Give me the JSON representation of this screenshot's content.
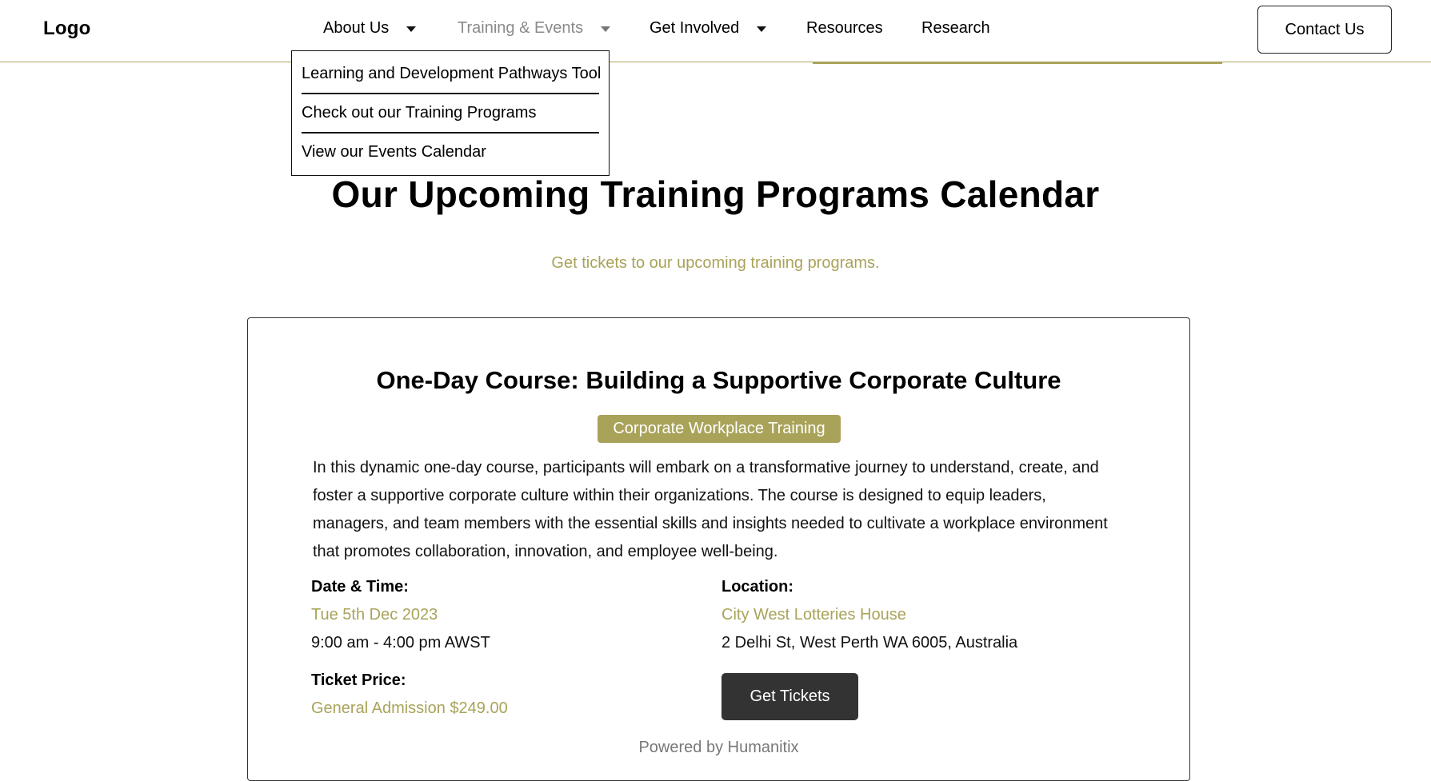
{
  "header": {
    "logo": "Logo",
    "nav": [
      {
        "label": "About Us"
      },
      {
        "label": "Training & Events"
      },
      {
        "label": "Get Involved"
      },
      {
        "label": "Resources"
      },
      {
        "label": "Research"
      }
    ],
    "contact_label": "Contact Us"
  },
  "dropdown": {
    "items": [
      {
        "label": "Learning and Development Pathways Tool"
      },
      {
        "label": "Check out our Training Programs"
      },
      {
        "label": "View our Events Calendar"
      }
    ]
  },
  "main": {
    "title": "Our Upcoming Training Programs Calendar",
    "subtitle": "Get tickets to our upcoming training programs."
  },
  "event": {
    "title": "One-Day Course: Building a Supportive Corporate Culture",
    "category": "Corporate Workplace Training",
    "description": "In this dynamic one-day course, participants will embark on a transformative journey to understand, create, and foster a supportive corporate culture within their organizations. The course is designed to equip leaders, managers, and team members with the essential skills and insights needed to cultivate a workplace environment that promotes collaboration, innovation, and employee well-being.",
    "datetime_label": "Date & Time:",
    "date": "Tue 5th Dec 2023",
    "time": "9:00 am - 4:00 pm AWST",
    "location_label": "Location:",
    "venue": "City West Lotteries House",
    "address": "2 Delhi St, West Perth WA 6005, Australia",
    "price_label": "Ticket Price:",
    "price": "General Admission $249.00",
    "tickets_button": "Get Tickets",
    "powered_by": "Powered by Humanitix"
  },
  "colors": {
    "accent": "#a9a35a",
    "button_dark": "#333333"
  }
}
